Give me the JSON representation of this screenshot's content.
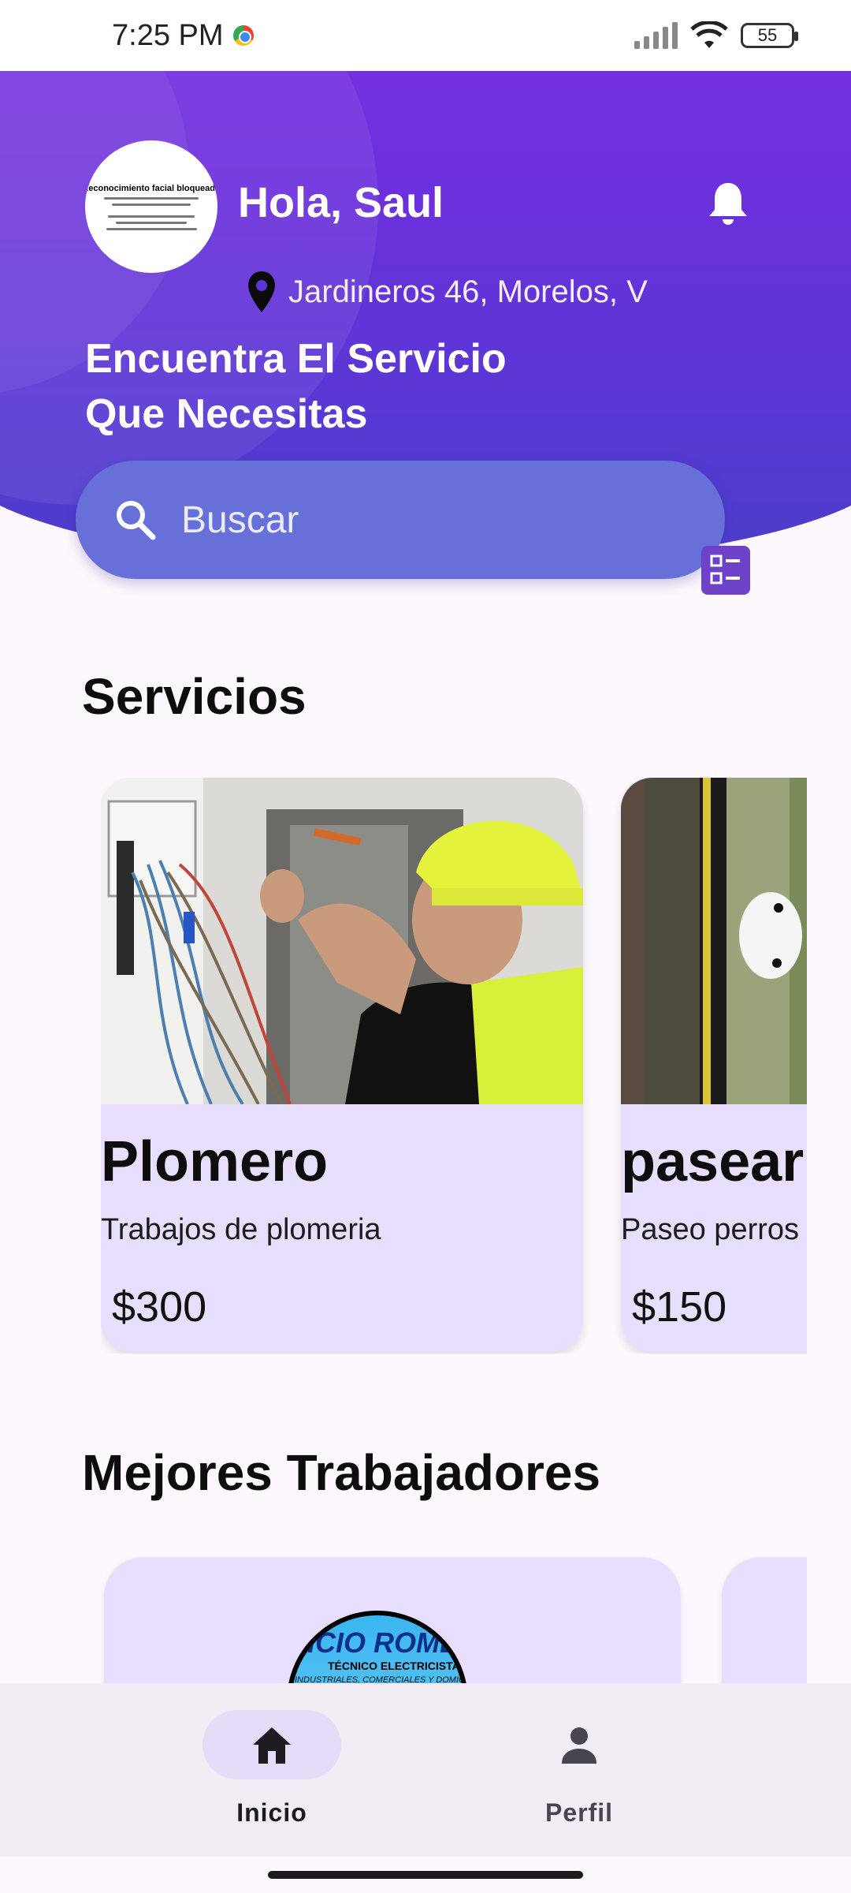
{
  "status_bar": {
    "time": "7:25 PM",
    "battery": "55"
  },
  "header": {
    "greeting": "Hola, Saul",
    "location": "Jardineros 46, Morelos, V",
    "title_line1": "Encuentra El Servicio",
    "title_line2": "Que Necesitas",
    "avatar_text": "Reconocimiento facial bloqueado"
  },
  "search": {
    "placeholder": "Buscar"
  },
  "sections": {
    "services_title": "Servicios",
    "workers_title": "Mejores Trabajadores"
  },
  "services": [
    {
      "name": "Plomero",
      "description": "Trabajos de plomeria",
      "price": "$300"
    },
    {
      "name": "pasear",
      "description": "Paseo perros",
      "price": "$150"
    }
  ],
  "workers": [
    {
      "logo_title": "RICIO ROMER",
      "logo_subtitle": "TÉCNICO ELECTRICISTA",
      "logo_tagline": "INDUSTRIALES, COMERCIALES Y DOMICILIARIAS"
    }
  ],
  "bottom_nav": {
    "home_label": "Inicio",
    "profile_label": "Perfil"
  },
  "colors": {
    "header_gradient_top": "#7a2fe0",
    "header_gradient_bottom": "#4a3fc8",
    "search_bg": "#6670d8",
    "card_bg": "#e7dffd",
    "nav_bg": "#f2ecf4"
  }
}
